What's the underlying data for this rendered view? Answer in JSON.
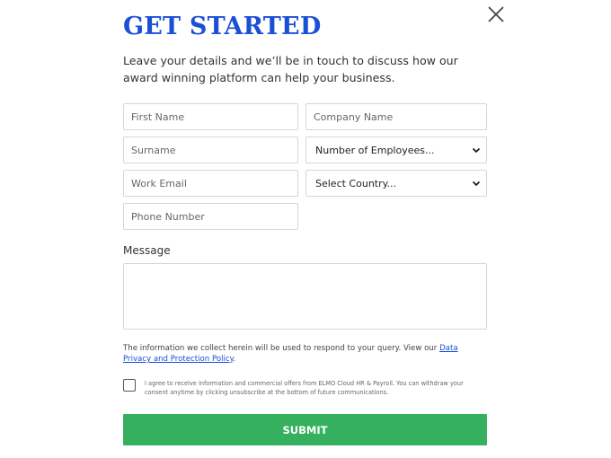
{
  "header": {
    "title": "GET STARTED",
    "intro": "Leave your details and we’ll be in touch to discuss how our award winning platform can help your business."
  },
  "icons": {
    "close": "close-icon",
    "select_arrow": "chevron-down-icon"
  },
  "form": {
    "first_name_placeholder": "First Name",
    "company_name_placeholder": "Company Name",
    "surname_placeholder": "Surname",
    "employees_select": "Number of Employees...",
    "work_email_placeholder": "Work Email",
    "country_select": "Select Country...",
    "phone_placeholder": "Phone Number",
    "message_label": "Message",
    "message_value": ""
  },
  "privacy": {
    "text": "The information we collect herein will be used to respond to your query. View our ",
    "link": "Data Privacy and Protection Policy",
    "after": "."
  },
  "consent": {
    "checked": false,
    "text": "I agree to receive information and commercial offers from ELMO Cloud HR & Payroll. You can withdraw your consent anytime by clicking unsubscribe at the bottom of future communications."
  },
  "submit_label": "SUBMIT",
  "colors": {
    "title": "#1a4fd6",
    "submit": "#35b05e",
    "link": "#1a4fd6"
  }
}
